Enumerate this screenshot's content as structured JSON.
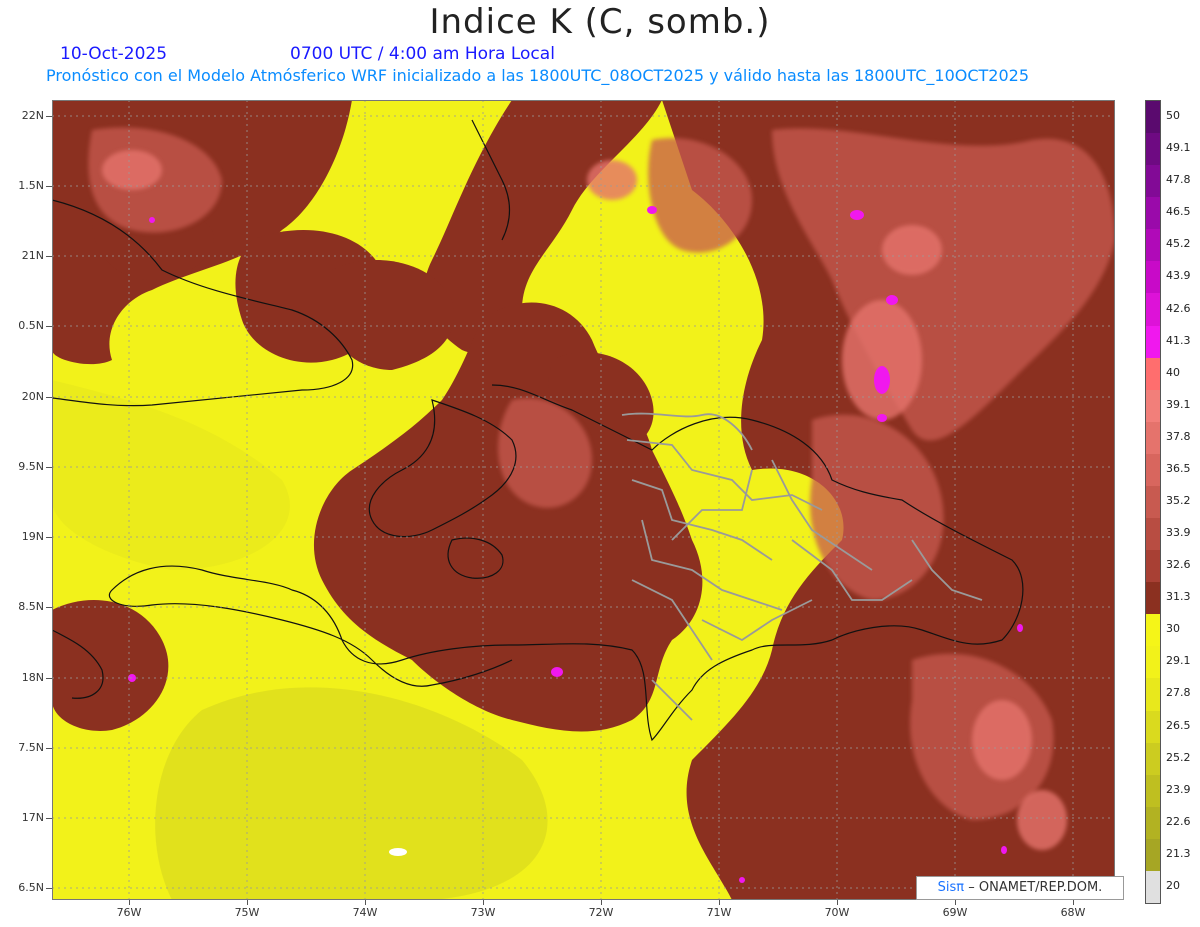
{
  "header": {
    "title": "Indice K (C, somb.)",
    "date": "10-Oct-2025",
    "time": "0700 UTC / 4:00 am Hora Local",
    "subtitle": "Pronóstico con el Modelo Atmósferico WRF inicializado a las 1800UTC_08OCT2025 y válido hasta las  1800UTC_10OCT2025"
  },
  "axes": {
    "y_labels": [
      "22N",
      "1.5N",
      "21N",
      "0.5N",
      "20N",
      "9.5N",
      "19N",
      "8.5N",
      "18N",
      "7.5N",
      "17N",
      "6.5N"
    ],
    "x_labels": [
      "76W",
      "75W",
      "74W",
      "73W",
      "72W",
      "71W",
      "70W",
      "69W",
      "68W"
    ],
    "grid": true
  },
  "colorbar": {
    "labels": [
      "50",
      "49.1",
      "47.8",
      "46.5",
      "45.2",
      "43.9",
      "42.6",
      "41.3",
      "40",
      "39.1",
      "37.8",
      "36.5",
      "35.2",
      "33.9",
      "32.6",
      "31.3",
      "30",
      "29.1",
      "27.8",
      "26.5",
      "25.2",
      "23.9",
      "22.6",
      "21.3",
      "20"
    ],
    "colors": [
      "#5a0a6e",
      "#6e0a82",
      "#820a96",
      "#9a0aaa",
      "#b00ab8",
      "#c80ac8",
      "#dd12d8",
      "#f018ee",
      "#ff6e6e",
      "#f27f7a",
      "#e5736c",
      "#d8665e",
      "#c85a50",
      "#b84d42",
      "#a84034",
      "#8b3020",
      "#f5f518",
      "#f2f21a",
      "#e8e81c",
      "#dada1e",
      "#cccc20",
      "#bfbf20",
      "#b2b222",
      "#a6a624",
      "#e0e0e0"
    ]
  },
  "credit": {
    "sis": "Sisπ",
    "text": "– ONAMET/REP.DOM."
  }
}
